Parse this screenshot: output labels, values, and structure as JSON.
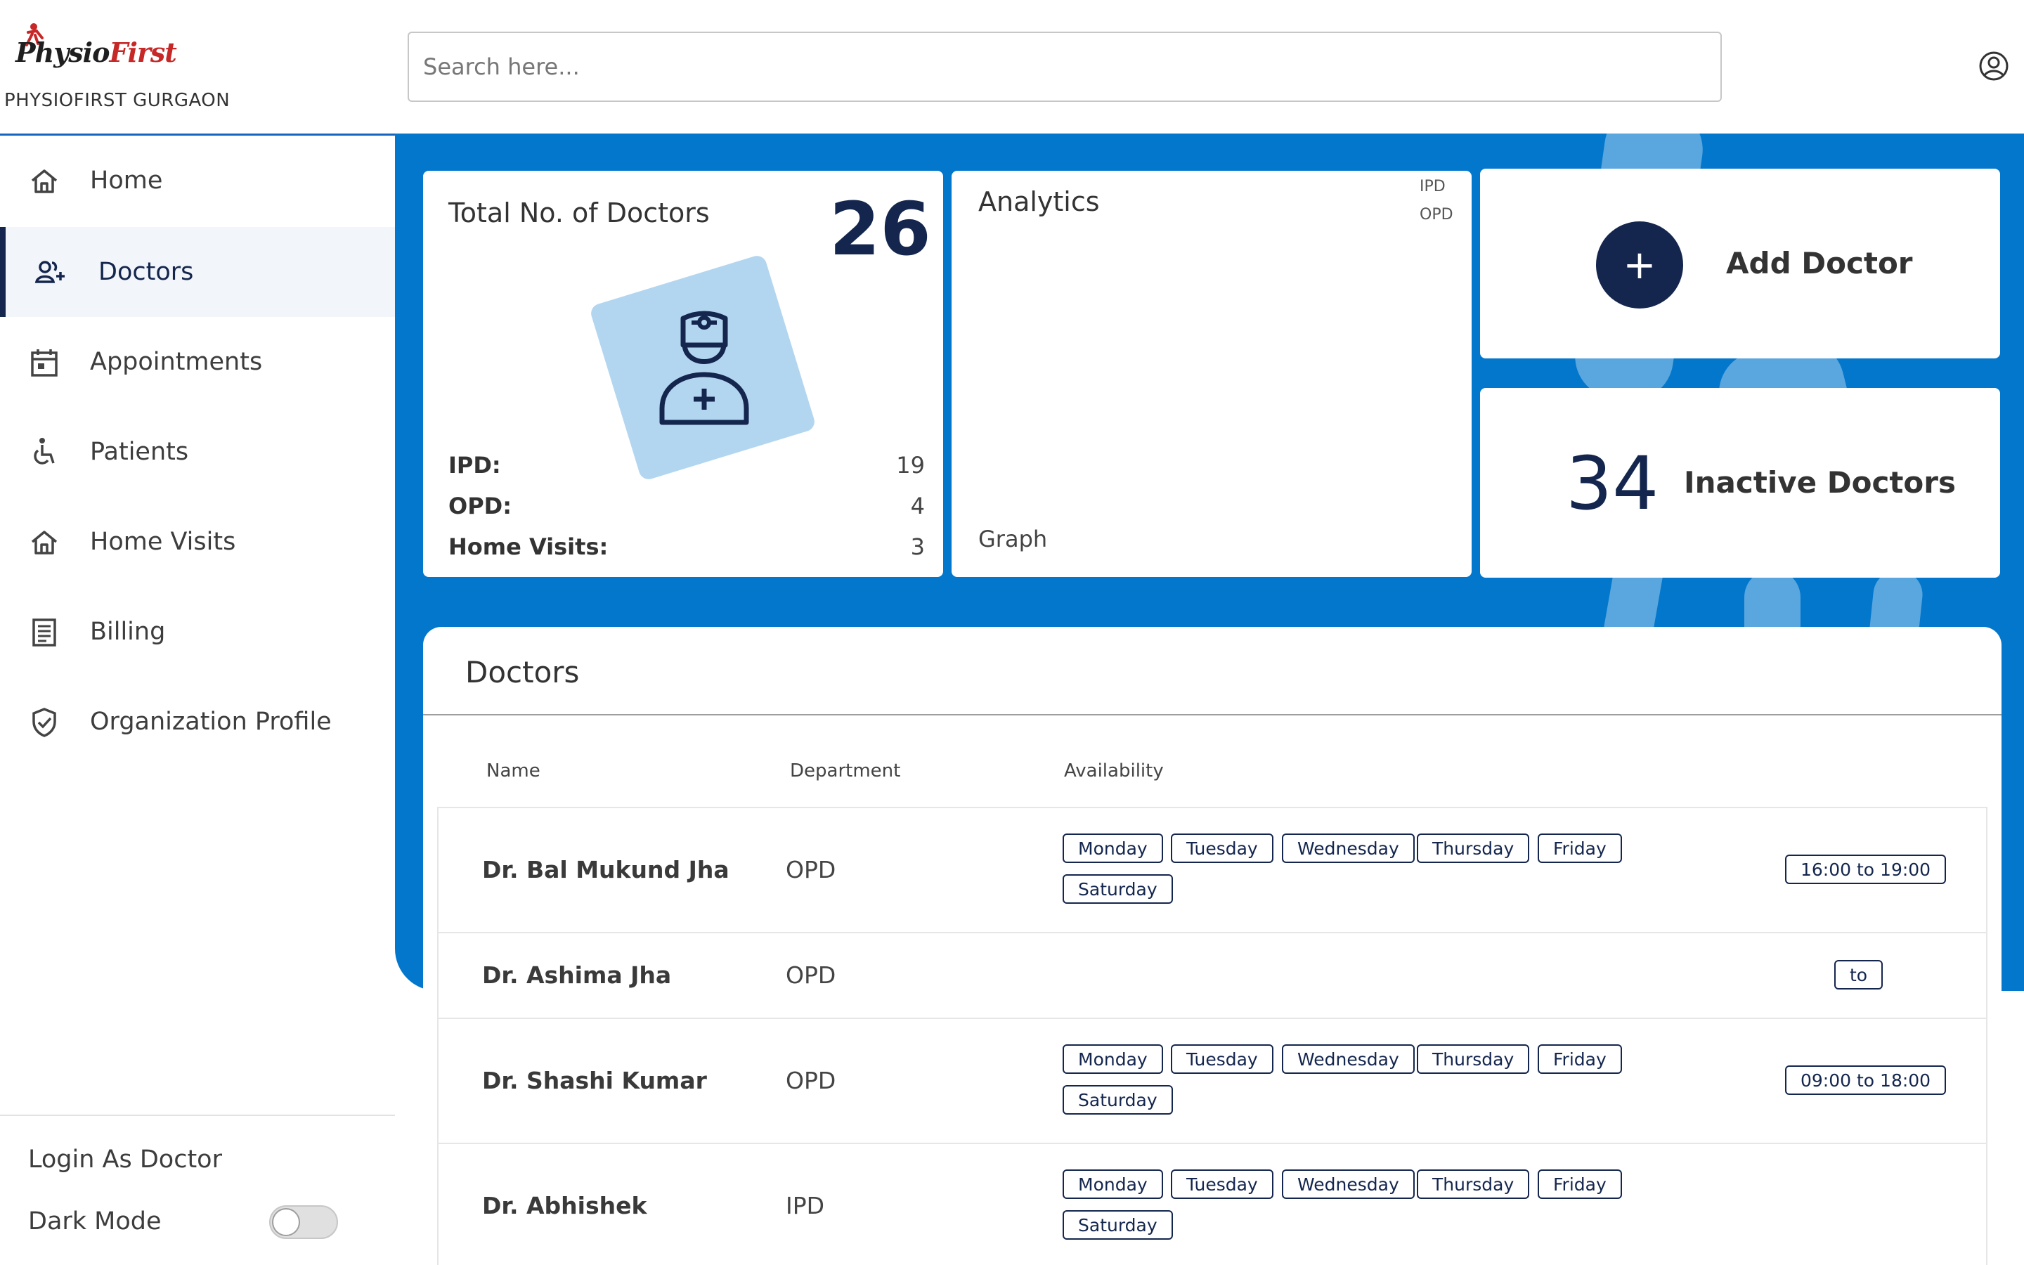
{
  "brand": {
    "logo_part1": "Physio",
    "logo_part2": "First",
    "org_name": "PHYSIOFIRST GURGAON"
  },
  "search": {
    "placeholder": "Search here..."
  },
  "sidebar": {
    "items": [
      {
        "label": "Home",
        "icon": "home-icon"
      },
      {
        "label": "Doctors",
        "icon": "doctors-icon",
        "active": true
      },
      {
        "label": "Appointments",
        "icon": "calendar-icon"
      },
      {
        "label": "Patients",
        "icon": "wheelchair-icon"
      },
      {
        "label": "Home Visits",
        "icon": "home-visit-icon"
      },
      {
        "label": "Billing",
        "icon": "receipt-icon"
      },
      {
        "label": "Organization Profile",
        "icon": "verified-badge-icon"
      }
    ],
    "login_as_doctor": "Login As Doctor",
    "dark_mode": "Dark Mode",
    "dark_mode_on": false
  },
  "stats": {
    "total_title": "Total No. of Doctors",
    "total_value": "26",
    "ipd_label": "IPD:",
    "ipd_value": "19",
    "opd_label": "OPD:",
    "opd_value": "4",
    "home_label": "Home Visits:",
    "home_value": "3"
  },
  "analytics": {
    "title": "Analytics",
    "legend": [
      "IPD",
      "OPD"
    ],
    "graph_label": "Graph"
  },
  "add_doctor": {
    "label": "Add Doctor",
    "icon": "plus-icon"
  },
  "inactive": {
    "value": "34",
    "label": "Inactive Doctors"
  },
  "doctors": {
    "title": "Doctors",
    "columns": [
      "Name",
      "Department",
      "Availability"
    ],
    "rows": [
      {
        "name": "Dr. Bal Mukund Jha",
        "department": "OPD",
        "days": [
          "Monday",
          "Tuesday",
          "Wednesday",
          "Thursday",
          "Friday",
          "Saturday"
        ],
        "hours": "16:00 to 19:00"
      },
      {
        "name": "Dr. Ashima Jha",
        "department": "OPD",
        "days": [],
        "hours": "to"
      },
      {
        "name": "Dr. Shashi Kumar",
        "department": "OPD",
        "days": [
          "Monday",
          "Tuesday",
          "Wednesday",
          "Thursday",
          "Friday",
          "Saturday"
        ],
        "hours": "09:00 to 18:00"
      },
      {
        "name": "Dr. Abhishek",
        "department": "IPD",
        "days": [
          "Monday",
          "Tuesday",
          "Wednesday",
          "Thursday",
          "Friday",
          "Saturday"
        ],
        "hours": ""
      }
    ]
  },
  "colors": {
    "primary_blue": "#0377cc",
    "navy": "#14264e",
    "tile_blue": "#b3d6f0"
  }
}
